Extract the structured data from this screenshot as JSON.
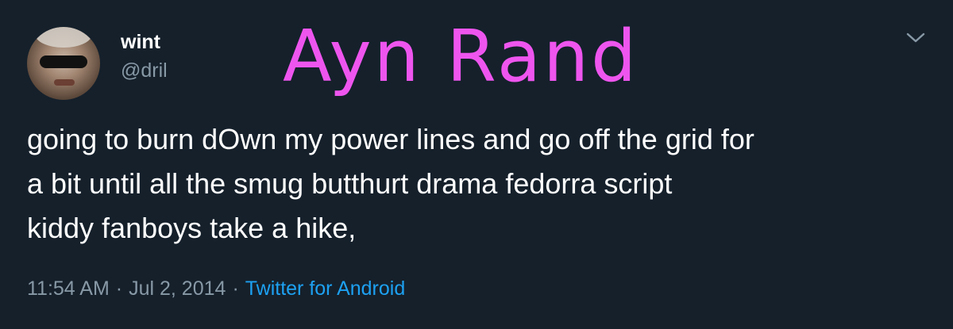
{
  "overlay": {
    "caption": "Ayn Rand",
    "color": "#ee55ee"
  },
  "author": {
    "name": "wint",
    "handle": "@dril",
    "avatar_icon": "user-avatar-photo"
  },
  "tweet": {
    "text": "going to burn dOwn my power lines and go off the grid for\na bit until all the smug butthurt  drama fedorra script\nkiddy fanboys take a hike,",
    "time": "11:54 AM",
    "date": "Jul 2, 2014",
    "separator": "·",
    "source": "Twitter for Android"
  },
  "icons": {
    "menu": "chevron-down-icon"
  },
  "colors": {
    "background": "#15202b",
    "secondary_text": "#8899a6",
    "link": "#1da1f2"
  }
}
